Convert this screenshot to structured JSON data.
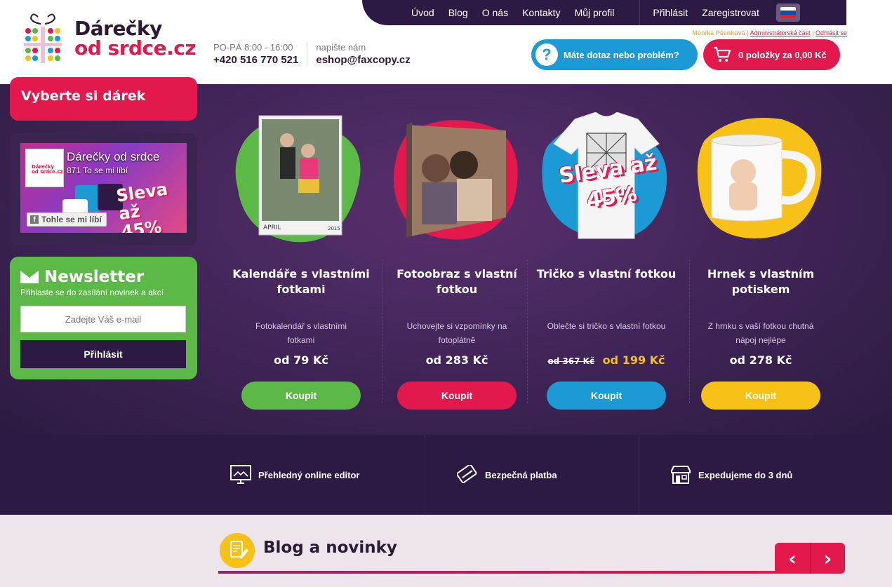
{
  "brand": {
    "line1": "Dárečky",
    "line2": "od srdce.cz"
  },
  "topnav": {
    "items": [
      "Úvod",
      "Blog",
      "O nás",
      "Kontakty",
      "Můj profil"
    ],
    "login": "Přihlásit",
    "register": "Zaregistrovat"
  },
  "contact": {
    "hours_label": "PO-PÁ 8:00 - 16:00",
    "phone": "+420 516 770 521",
    "email_label": "napište nám",
    "email": "eshop@faxcopy.cz"
  },
  "admin": {
    "user": "Monika Pšenková",
    "admin_link": "Administrátorská část",
    "logout_link": "Odhlásit se"
  },
  "help_button": "Máte dotaz nebo problém?",
  "cart_button": "0 položky za 0,00 Kč",
  "sidebar": {
    "title": "Vyberte si dárek",
    "fb": {
      "name": "Dárečky od srdce",
      "likes": "871 To se mi líbí",
      "like_button": "Tohle se mi líbí",
      "promo": "Sleva až 45%"
    },
    "newsletter": {
      "title": "Newsletter",
      "subtitle": "Přihlaste se do zasílání novinek a akcí",
      "placeholder": "Zadejte Váš e-mail",
      "button": "Přihlásit"
    }
  },
  "products": [
    {
      "name": "Kalendáře s vlastními fotkami",
      "desc": "Fotokalendář s vlastními fotkami",
      "price": "od 79 Kč",
      "button": "Koupit",
      "color": "#5cb947"
    },
    {
      "name": "Fotoobraz s vlastní fotkou",
      "desc": "Uchovejte si vzpomínky na fotoplátně",
      "price": "od 283 Kč",
      "button": "Koupit",
      "color": "#e3194d"
    },
    {
      "name": "Tričko s vlastní fotkou",
      "desc": "Oblečte si tričko s vlastní fotkou",
      "old_price": "od 367 Kč",
      "price": "od 199 Kč",
      "badge": "Sleva až 45%",
      "button": "Koupit",
      "color": "#1b9ad6"
    },
    {
      "name": "Hrnek s vlastním potiskem",
      "desc": "Z hrnku s vaší fotkou chutná nápoj nejlépe",
      "price": "od 278 Kč",
      "button": "Koupit",
      "color": "#f7c117"
    }
  ],
  "features": [
    "Přehledný online editor",
    "Bezpečná platba",
    "Expedujeme do 3 dnů"
  ],
  "blog": {
    "title": "Blog a novinky",
    "prev": "‹",
    "next": "›"
  },
  "colors": {
    "pink": "#e3194d",
    "green": "#5cb947",
    "blue": "#1b9ad6",
    "yellow": "#f7c117",
    "dark": "#2d1a44"
  },
  "icons": [
    "gift-logo-icon",
    "help-icon",
    "cart-icon",
    "envelope-icon",
    "facebook-icon",
    "editor-icon",
    "card-icon",
    "shop-icon",
    "blog-icon",
    "arrow-left-icon",
    "arrow-right-icon",
    "slovak-flag-icon"
  ]
}
